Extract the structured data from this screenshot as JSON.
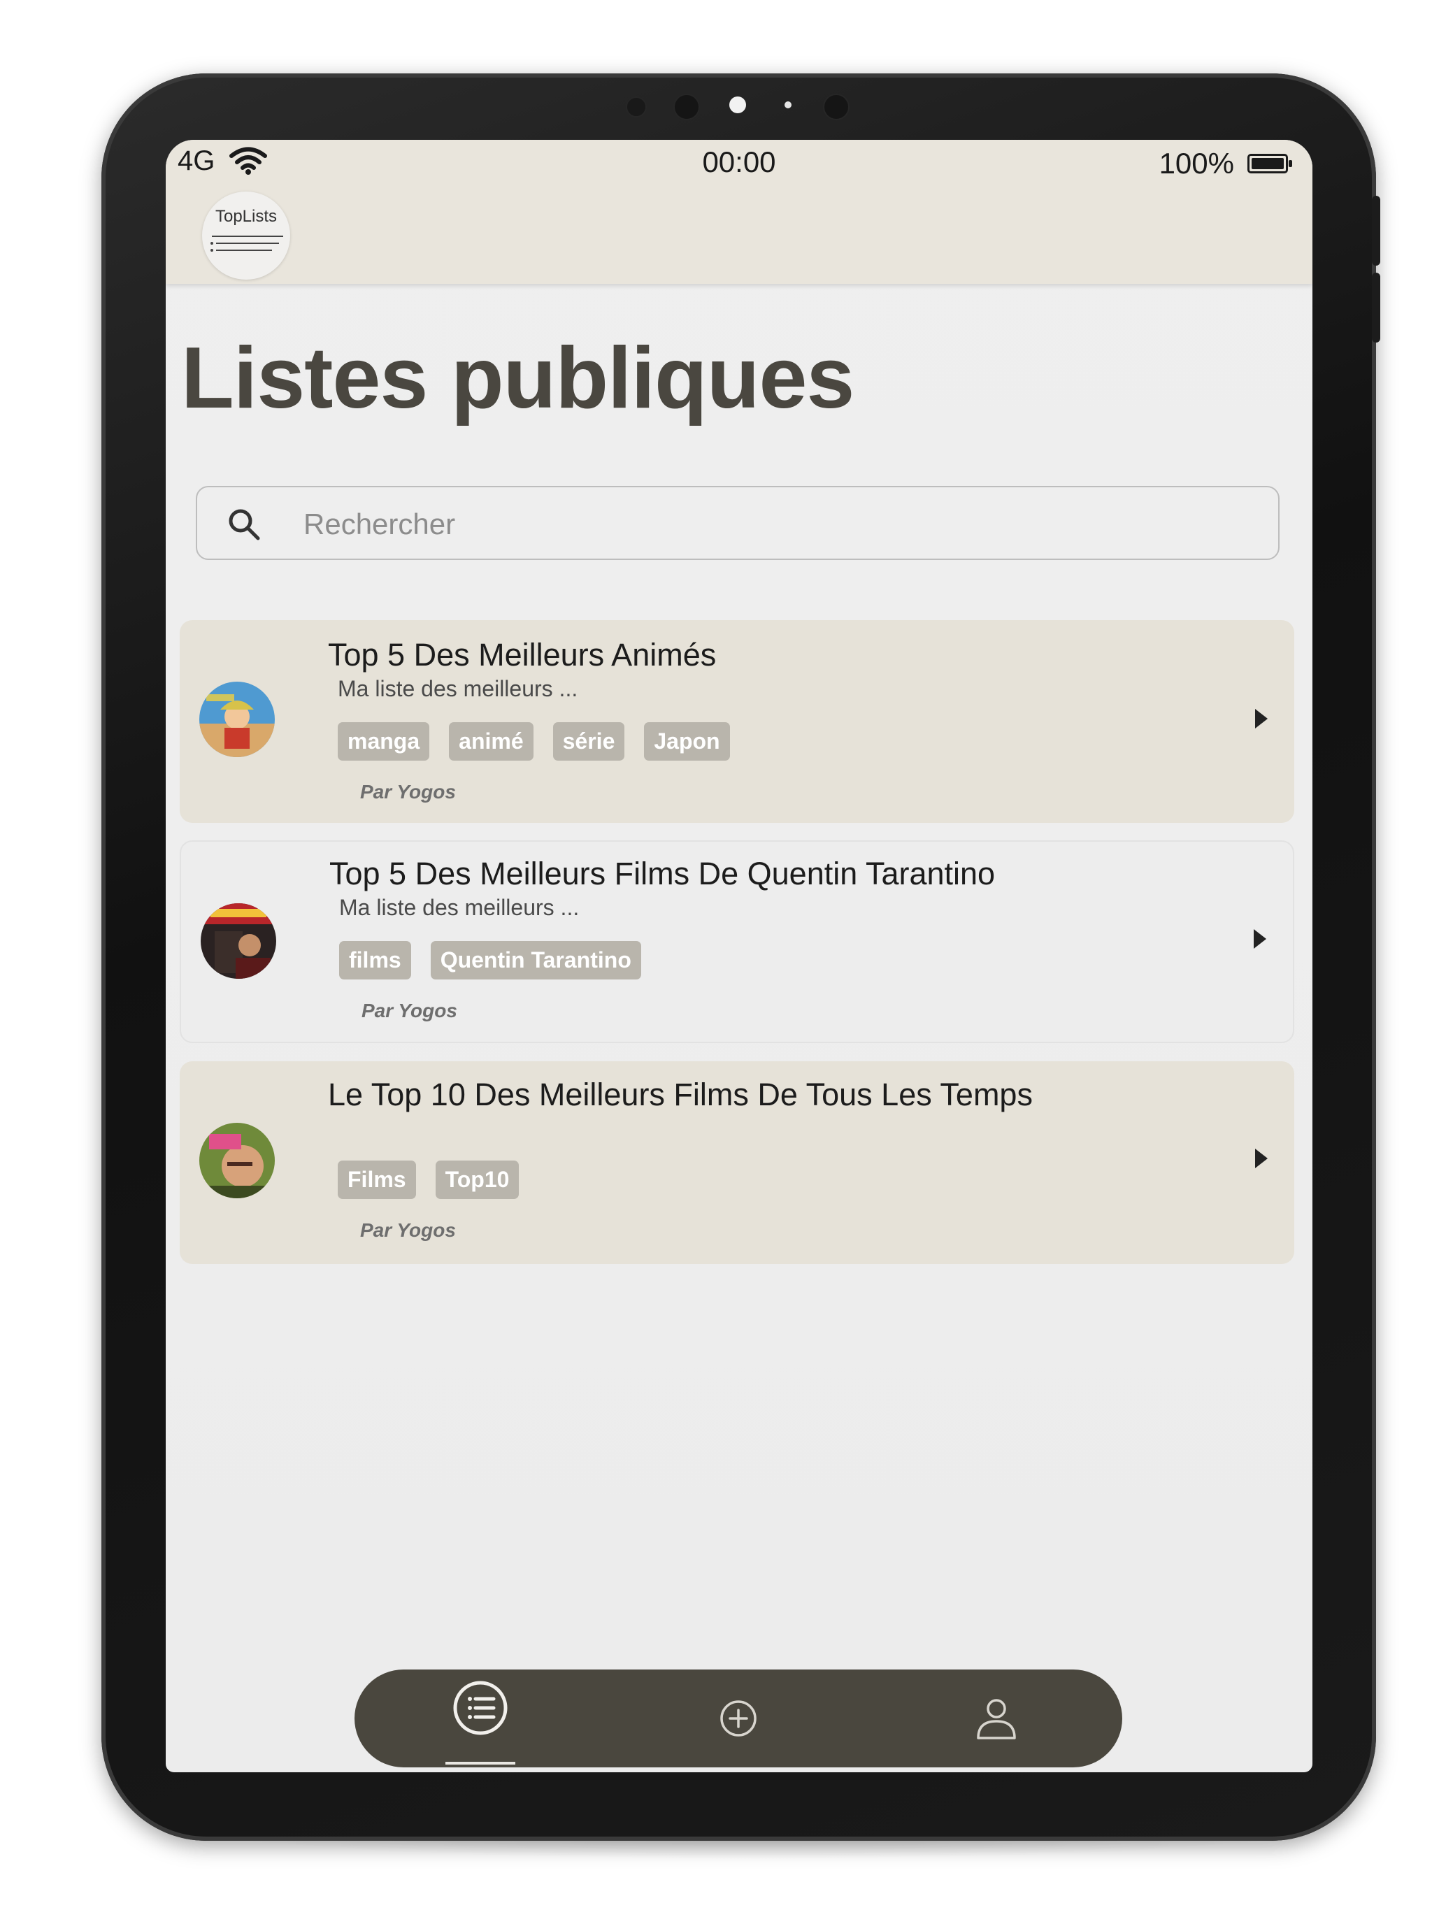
{
  "status_bar": {
    "carrier": "4G",
    "time": "00:00",
    "battery": "100%"
  },
  "app": {
    "logo_text": "TopLists"
  },
  "page": {
    "title": "Listes publiques"
  },
  "search": {
    "placeholder": "Rechercher",
    "value": ""
  },
  "lists": [
    {
      "title": "Top 5 Des Meilleurs Animés",
      "description": "Ma liste des meilleurs ...",
      "tags": [
        "manga",
        "animé",
        "série",
        "Japon"
      ],
      "author": "Par Yogos"
    },
    {
      "title": "Top 5 Des Meilleurs Films De Quentin Tarantino",
      "description": "Ma liste des meilleurs ...",
      "tags": [
        "films",
        "Quentin Tarantino"
      ],
      "author": "Par Yogos"
    },
    {
      "title": "Le Top 10 Des Meilleurs Films De Tous Les Temps",
      "description": "",
      "tags": [
        "Films",
        "Top10"
      ],
      "author": "Par Yogos"
    }
  ],
  "bottom_nav": {
    "items": [
      {
        "icon": "list-icon",
        "active": true
      },
      {
        "icon": "add-circle-icon",
        "active": false
      },
      {
        "icon": "user-icon",
        "active": false
      }
    ]
  },
  "colors": {
    "appbar": "#e9e5dc",
    "card_tan": "#e6e2d8",
    "tag_bg": "#b9b5ac",
    "nav_bg": "#4a473e",
    "title": "#4a4740"
  }
}
